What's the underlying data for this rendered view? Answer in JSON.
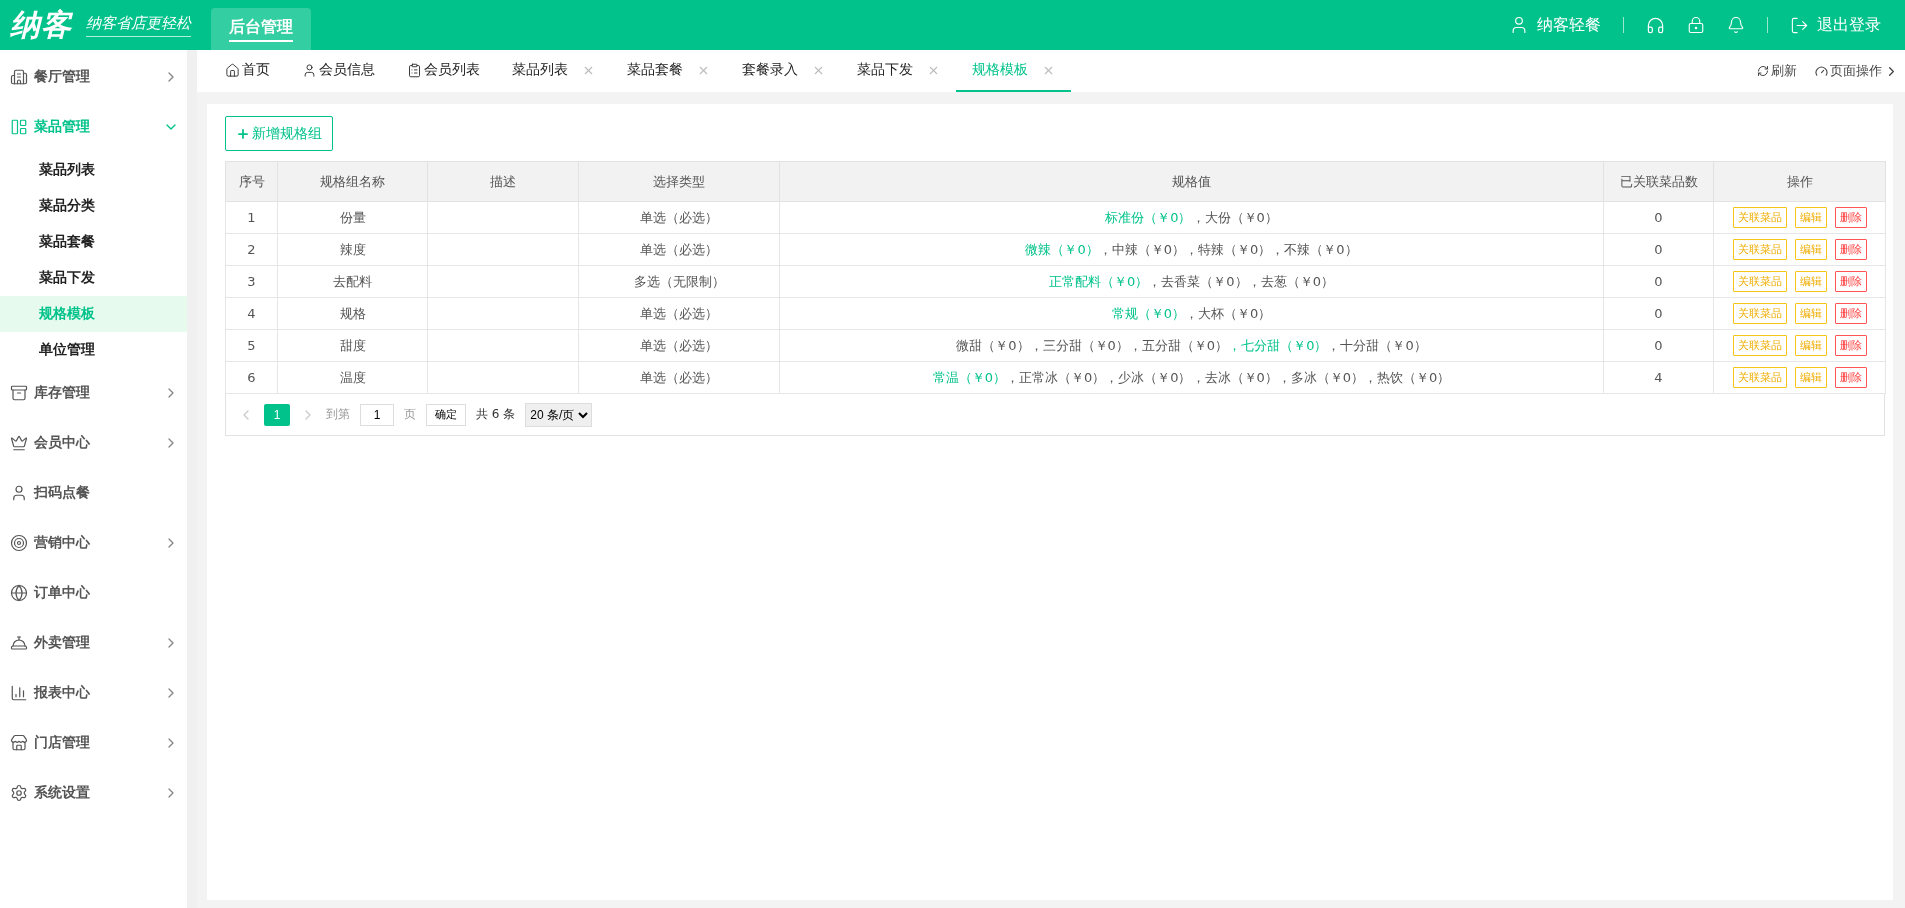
{
  "header": {
    "logo": "纳客",
    "slogan": "纳客省店更轻松",
    "nav_tab": "后台管理",
    "user": "纳客轻餐",
    "logout": "退出登录"
  },
  "sidebar": {
    "items": [
      {
        "label": "餐厅管理",
        "expanded": false,
        "has_arrow": true
      },
      {
        "label": "菜品管理",
        "expanded": true,
        "has_arrow": true,
        "children": [
          {
            "label": "菜品列表",
            "selected": false
          },
          {
            "label": "菜品分类",
            "selected": false
          },
          {
            "label": "菜品套餐",
            "selected": false
          },
          {
            "label": "菜品下发",
            "selected": false
          },
          {
            "label": "规格模板",
            "selected": true
          },
          {
            "label": "单位管理",
            "selected": false
          }
        ]
      },
      {
        "label": "库存管理",
        "expanded": false,
        "has_arrow": true
      },
      {
        "label": "会员中心",
        "expanded": false,
        "has_arrow": true
      },
      {
        "label": "扫码点餐",
        "expanded": false,
        "has_arrow": false
      },
      {
        "label": "营销中心",
        "expanded": false,
        "has_arrow": true
      },
      {
        "label": "订单中心",
        "expanded": false,
        "has_arrow": false
      },
      {
        "label": "外卖管理",
        "expanded": false,
        "has_arrow": true
      },
      {
        "label": "报表中心",
        "expanded": false,
        "has_arrow": true
      },
      {
        "label": "门店管理",
        "expanded": false,
        "has_arrow": true
      },
      {
        "label": "系统设置",
        "expanded": false,
        "has_arrow": true
      }
    ]
  },
  "tabs": [
    {
      "label": "首页",
      "selected": false,
      "closable": false
    },
    {
      "label": "会员信息",
      "selected": false,
      "closable": false
    },
    {
      "label": "会员列表",
      "selected": false,
      "closable": false
    },
    {
      "label": "菜品列表",
      "selected": false,
      "closable": true
    },
    {
      "label": "菜品套餐",
      "selected": false,
      "closable": true
    },
    {
      "label": "套餐录入",
      "selected": false,
      "closable": true
    },
    {
      "label": "菜品下发",
      "selected": false,
      "closable": true
    },
    {
      "label": "规格模板",
      "selected": true,
      "closable": true
    }
  ],
  "tab_actions": {
    "refresh": "刷新",
    "page_ops": "页面操作"
  },
  "add_button": "新增规格组",
  "table": {
    "columns": [
      "序号",
      "规格组名称",
      "描述",
      "选择类型",
      "规格值",
      "已关联菜品数",
      "操作"
    ],
    "rows": [
      {
        "index": "1",
        "name": "份量",
        "type": "单选（必选）",
        "values": [
          {
            "text": "标准份（￥0）",
            "default": true
          },
          {
            "text": "，大份（￥0）",
            "default": false
          }
        ],
        "linked": "0",
        "actions": [
          "关联菜品",
          "编辑",
          "删除"
        ]
      },
      {
        "index": "2",
        "name": "辣度",
        "type": "单选（必选）",
        "values": [
          {
            "text": "微辣（￥0）",
            "default": true
          },
          {
            "text": "，中辣（￥0）",
            "default": false
          },
          {
            "text": "，特辣（￥0）",
            "default": false
          },
          {
            "text": "，不辣（￥0）",
            "default": false
          }
        ],
        "linked": "0",
        "actions": [
          "关联菜品",
          "编辑",
          "删除"
        ]
      },
      {
        "index": "3",
        "name": "去配料",
        "type": "多选（无限制）",
        "values": [
          {
            "text": "正常配料（￥0）",
            "default": true
          },
          {
            "text": "，去香菜（￥0）",
            "default": false
          },
          {
            "text": "，去葱（￥0）",
            "default": false
          }
        ],
        "linked": "0",
        "actions": [
          "关联菜品",
          "编辑",
          "删除"
        ]
      },
      {
        "index": "4",
        "name": "规格",
        "type": "单选（必选）",
        "values": [
          {
            "text": "常规（￥0）",
            "default": true
          },
          {
            "text": "，大杯（￥0）",
            "default": false
          }
        ],
        "linked": "0",
        "actions": [
          "关联菜品",
          "编辑",
          "删除"
        ]
      },
      {
        "index": "5",
        "name": "甜度",
        "type": "单选（必选）",
        "values": [
          {
            "text": "微甜（￥0）",
            "default": false
          },
          {
            "text": "，三分甜（￥0）",
            "default": false
          },
          {
            "text": "，五分甜（￥0）",
            "default": false
          },
          {
            "text": "，七分甜（￥0）",
            "default": true
          },
          {
            "text": "，十分甜（￥0）",
            "default": false
          }
        ],
        "linked": "0",
        "actions": [
          "关联菜品",
          "编辑",
          "删除"
        ]
      },
      {
        "index": "6",
        "name": "温度",
        "type": "单选（必选）",
        "values": [
          {
            "text": "常温（￥0）",
            "default": true
          },
          {
            "text": "，正常冰（￥0）",
            "default": false
          },
          {
            "text": "，少冰（￥0）",
            "default": false
          },
          {
            "text": "，去冰（￥0）",
            "default": false
          },
          {
            "text": "，多冰（￥0）",
            "default": false
          },
          {
            "text": "，热饮（￥0）",
            "default": false
          }
        ],
        "linked": "4",
        "actions": [
          "关联菜品",
          "编辑",
          "删除"
        ]
      }
    ]
  },
  "pagination": {
    "pages": [
      {
        "label": "1",
        "selected": true
      }
    ],
    "goto_label": "到第",
    "page_input": "1",
    "page_unit": "页",
    "confirm": "确定",
    "total": "共 6 条",
    "page_size": "20 条/页"
  }
}
